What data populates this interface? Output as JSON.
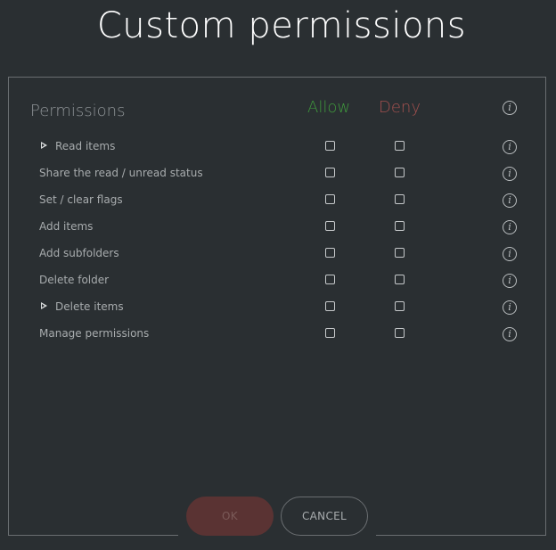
{
  "dialog": {
    "title": "Custom permissions"
  },
  "headers": {
    "permissions": "Permissions",
    "allow": "Allow",
    "deny": "Deny"
  },
  "rows": [
    {
      "label": "Read items",
      "expandable": true,
      "allow": false,
      "deny": false
    },
    {
      "label": "Share the read / unread status",
      "expandable": false,
      "allow": false,
      "deny": false
    },
    {
      "label": "Set / clear flags",
      "expandable": false,
      "allow": false,
      "deny": false
    },
    {
      "label": "Add items",
      "expandable": false,
      "allow": false,
      "deny": false
    },
    {
      "label": "Add subfolders",
      "expandable": false,
      "allow": false,
      "deny": false
    },
    {
      "label": "Delete folder",
      "expandable": false,
      "allow": false,
      "deny": false
    },
    {
      "label": "Delete items",
      "expandable": true,
      "allow": false,
      "deny": false
    },
    {
      "label": "Manage permissions",
      "expandable": false,
      "allow": false,
      "deny": false
    }
  ],
  "buttons": {
    "ok": "OK",
    "cancel": "CANCEL"
  },
  "colors": {
    "allow": "#3f9a3c",
    "deny": "#a4514f",
    "background": "#2a2f32",
    "ok_disabled": "#5a3333"
  },
  "icons": {
    "info": "info-icon",
    "expand": "expand-triangle-icon"
  }
}
